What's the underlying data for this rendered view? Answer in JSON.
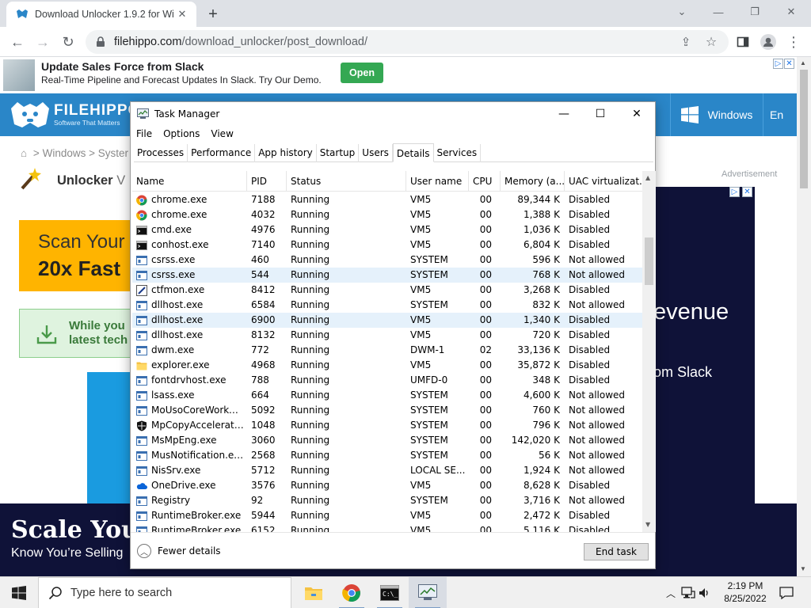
{
  "browser": {
    "tab_title": "Download Unlocker 1.9.2 for Wi",
    "url_host": "filehippo.com",
    "url_path": "/download_unlocker/post_download/"
  },
  "page": {
    "ad_title": "Update Sales Force from Slack",
    "ad_subtitle": "Real-Time Pipeline and Forecast Updates In Slack. Try Our Demo.",
    "ad_button": "Open",
    "brand": "FILEHIPPO",
    "brand_tagline": "Software That Matters",
    "nav_windows": "Windows",
    "nav_lang": "En",
    "breadcrumb": "Windows  >  Syster",
    "product_title": "Unlocker",
    "product_version_fragment": "V",
    "advertisement_label": "Advertisement",
    "scan_line1": "Scan Your",
    "scan_line2": "20x Fast",
    "green_line1": "While you",
    "green_line2": "latest tech",
    "right_ad_line1": "evenue",
    "right_ad_line2": "om Slack",
    "bottom_ad_line1": "Scale Your",
    "bottom_ad_line2": "Know You’re Selling"
  },
  "taskmanager": {
    "title": "Task Manager",
    "menu": [
      "File",
      "Options",
      "View"
    ],
    "tabs": [
      "Processes",
      "Performance",
      "App history",
      "Startup",
      "Users",
      "Details",
      "Services"
    ],
    "active_tab": "Details",
    "columns": {
      "name": "Name",
      "pid": "PID",
      "status": "Status",
      "user": "User name",
      "cpu": "CPU",
      "mem": "Memory (a...",
      "uac": "UAC virtualizat..."
    },
    "processes": [
      {
        "name": "chrome.exe",
        "pid": "7188",
        "status": "Running",
        "user": "VM5",
        "cpu": "00",
        "mem": "89,344 K",
        "uac": "Disabled",
        "icon": "chrome-icon"
      },
      {
        "name": "chrome.exe",
        "pid": "4032",
        "status": "Running",
        "user": "VM5",
        "cpu": "00",
        "mem": "1,388 K",
        "uac": "Disabled",
        "icon": "chrome-icon"
      },
      {
        "name": "cmd.exe",
        "pid": "4976",
        "status": "Running",
        "user": "VM5",
        "cpu": "00",
        "mem": "1,036 K",
        "uac": "Disabled",
        "icon": "console-icon"
      },
      {
        "name": "conhost.exe",
        "pid": "7140",
        "status": "Running",
        "user": "VM5",
        "cpu": "00",
        "mem": "6,804 K",
        "uac": "Disabled",
        "icon": "console-icon"
      },
      {
        "name": "csrss.exe",
        "pid": "460",
        "status": "Running",
        "user": "SYSTEM",
        "cpu": "00",
        "mem": "596 K",
        "uac": "Not allowed",
        "icon": "process-icon"
      },
      {
        "name": "csrss.exe",
        "pid": "544",
        "status": "Running",
        "user": "SYSTEM",
        "cpu": "00",
        "mem": "768 K",
        "uac": "Not allowed",
        "icon": "process-icon"
      },
      {
        "name": "ctfmon.exe",
        "pid": "8412",
        "status": "Running",
        "user": "VM5",
        "cpu": "00",
        "mem": "3,268 K",
        "uac": "Disabled",
        "icon": "pen-icon"
      },
      {
        "name": "dllhost.exe",
        "pid": "6584",
        "status": "Running",
        "user": "SYSTEM",
        "cpu": "00",
        "mem": "832 K",
        "uac": "Not allowed",
        "icon": "process-icon"
      },
      {
        "name": "dllhost.exe",
        "pid": "6900",
        "status": "Running",
        "user": "VM5",
        "cpu": "00",
        "mem": "1,340 K",
        "uac": "Disabled",
        "icon": "process-icon"
      },
      {
        "name": "dllhost.exe",
        "pid": "8132",
        "status": "Running",
        "user": "VM5",
        "cpu": "00",
        "mem": "720 K",
        "uac": "Disabled",
        "icon": "process-icon"
      },
      {
        "name": "dwm.exe",
        "pid": "772",
        "status": "Running",
        "user": "DWM-1",
        "cpu": "02",
        "mem": "33,136 K",
        "uac": "Disabled",
        "icon": "process-icon"
      },
      {
        "name": "explorer.exe",
        "pid": "4968",
        "status": "Running",
        "user": "VM5",
        "cpu": "00",
        "mem": "35,872 K",
        "uac": "Disabled",
        "icon": "folder-icon"
      },
      {
        "name": "fontdrvhost.exe",
        "pid": "788",
        "status": "Running",
        "user": "UMFD-0",
        "cpu": "00",
        "mem": "348 K",
        "uac": "Disabled",
        "icon": "process-icon"
      },
      {
        "name": "lsass.exe",
        "pid": "664",
        "status": "Running",
        "user": "SYSTEM",
        "cpu": "00",
        "mem": "4,600 K",
        "uac": "Not allowed",
        "icon": "process-icon"
      },
      {
        "name": "MoUsoCoreWorker.e...",
        "pid": "5092",
        "status": "Running",
        "user": "SYSTEM",
        "cpu": "00",
        "mem": "760 K",
        "uac": "Not allowed",
        "icon": "process-icon"
      },
      {
        "name": "MpCopyAccelerator....",
        "pid": "1048",
        "status": "Running",
        "user": "SYSTEM",
        "cpu": "00",
        "mem": "796 K",
        "uac": "Not allowed",
        "icon": "shield-icon"
      },
      {
        "name": "MsMpEng.exe",
        "pid": "3060",
        "status": "Running",
        "user": "SYSTEM",
        "cpu": "00",
        "mem": "142,020 K",
        "uac": "Not allowed",
        "icon": "process-icon"
      },
      {
        "name": "MusNotification.exe",
        "pid": "2568",
        "status": "Running",
        "user": "SYSTEM",
        "cpu": "00",
        "mem": "56 K",
        "uac": "Not allowed",
        "icon": "process-icon"
      },
      {
        "name": "NisSrv.exe",
        "pid": "5712",
        "status": "Running",
        "user": "LOCAL SE...",
        "cpu": "00",
        "mem": "1,924 K",
        "uac": "Not allowed",
        "icon": "process-icon"
      },
      {
        "name": "OneDrive.exe",
        "pid": "3576",
        "status": "Running",
        "user": "VM5",
        "cpu": "00",
        "mem": "8,628 K",
        "uac": "Disabled",
        "icon": "cloud-icon"
      },
      {
        "name": "Registry",
        "pid": "92",
        "status": "Running",
        "user": "SYSTEM",
        "cpu": "00",
        "mem": "3,716 K",
        "uac": "Not allowed",
        "icon": "process-icon"
      },
      {
        "name": "RuntimeBroker.exe",
        "pid": "5944",
        "status": "Running",
        "user": "VM5",
        "cpu": "00",
        "mem": "2,472 K",
        "uac": "Disabled",
        "icon": "process-icon"
      },
      {
        "name": "RuntimeBroker.exe",
        "pid": "6152",
        "status": "Running",
        "user": "VM5",
        "cpu": "00",
        "mem": "5,116 K",
        "uac": "Disabled",
        "icon": "process-icon"
      }
    ],
    "highlighted_rows": [
      5,
      8
    ],
    "fewer_details": "Fewer details",
    "end_task": "End task"
  },
  "taskbar": {
    "search_placeholder": "Type here to search",
    "time": "2:19 PM",
    "date": "8/25/2022"
  },
  "colors": {
    "filehippo_blue": "#2a86c8",
    "ad_green": "#34a853",
    "selection": "#e5f1fb"
  }
}
